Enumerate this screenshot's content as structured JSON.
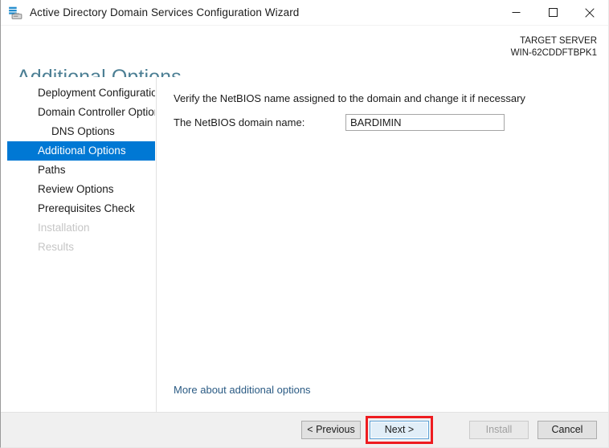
{
  "window": {
    "title": "Active Directory Domain Services Configuration Wizard",
    "icon": "ad-server-icon",
    "controls": {
      "minimize": "minimize-icon",
      "maximize": "maximize-icon",
      "close": "close-icon"
    }
  },
  "header": {
    "page_title": "Additional Options",
    "target_server_label": "TARGET SERVER",
    "target_server_name": "WIN-62CDDFTBPK1"
  },
  "sidebar": {
    "items": [
      {
        "label": "Deployment Configuration",
        "state": "done",
        "indent": false
      },
      {
        "label": "Domain Controller Options",
        "state": "done",
        "indent": false
      },
      {
        "label": "DNS Options",
        "state": "done",
        "indent": true
      },
      {
        "label": "Additional Options",
        "state": "selected",
        "indent": false
      },
      {
        "label": "Paths",
        "state": "done",
        "indent": false
      },
      {
        "label": "Review Options",
        "state": "done",
        "indent": false
      },
      {
        "label": "Prerequisites Check",
        "state": "done",
        "indent": false
      },
      {
        "label": "Installation",
        "state": "disabled",
        "indent": false
      },
      {
        "label": "Results",
        "state": "disabled",
        "indent": false
      }
    ]
  },
  "main": {
    "description": "Verify the NetBIOS name assigned to the domain and change it if necessary",
    "netbios_label": "The NetBIOS domain name:",
    "netbios_value": "BARDIMIN",
    "netbios_placeholder": "",
    "more_link": "More about additional options"
  },
  "footer": {
    "previous_label": "< Previous",
    "next_label": "Next >",
    "install_label": "Install",
    "cancel_label": "Cancel"
  },
  "colors": {
    "accent_selected": "#0078d4",
    "page_title": "#4c7f94",
    "link": "#2b5b84",
    "annotation_red": "#ee1c20",
    "focus_blue": "#5a9fd4"
  }
}
